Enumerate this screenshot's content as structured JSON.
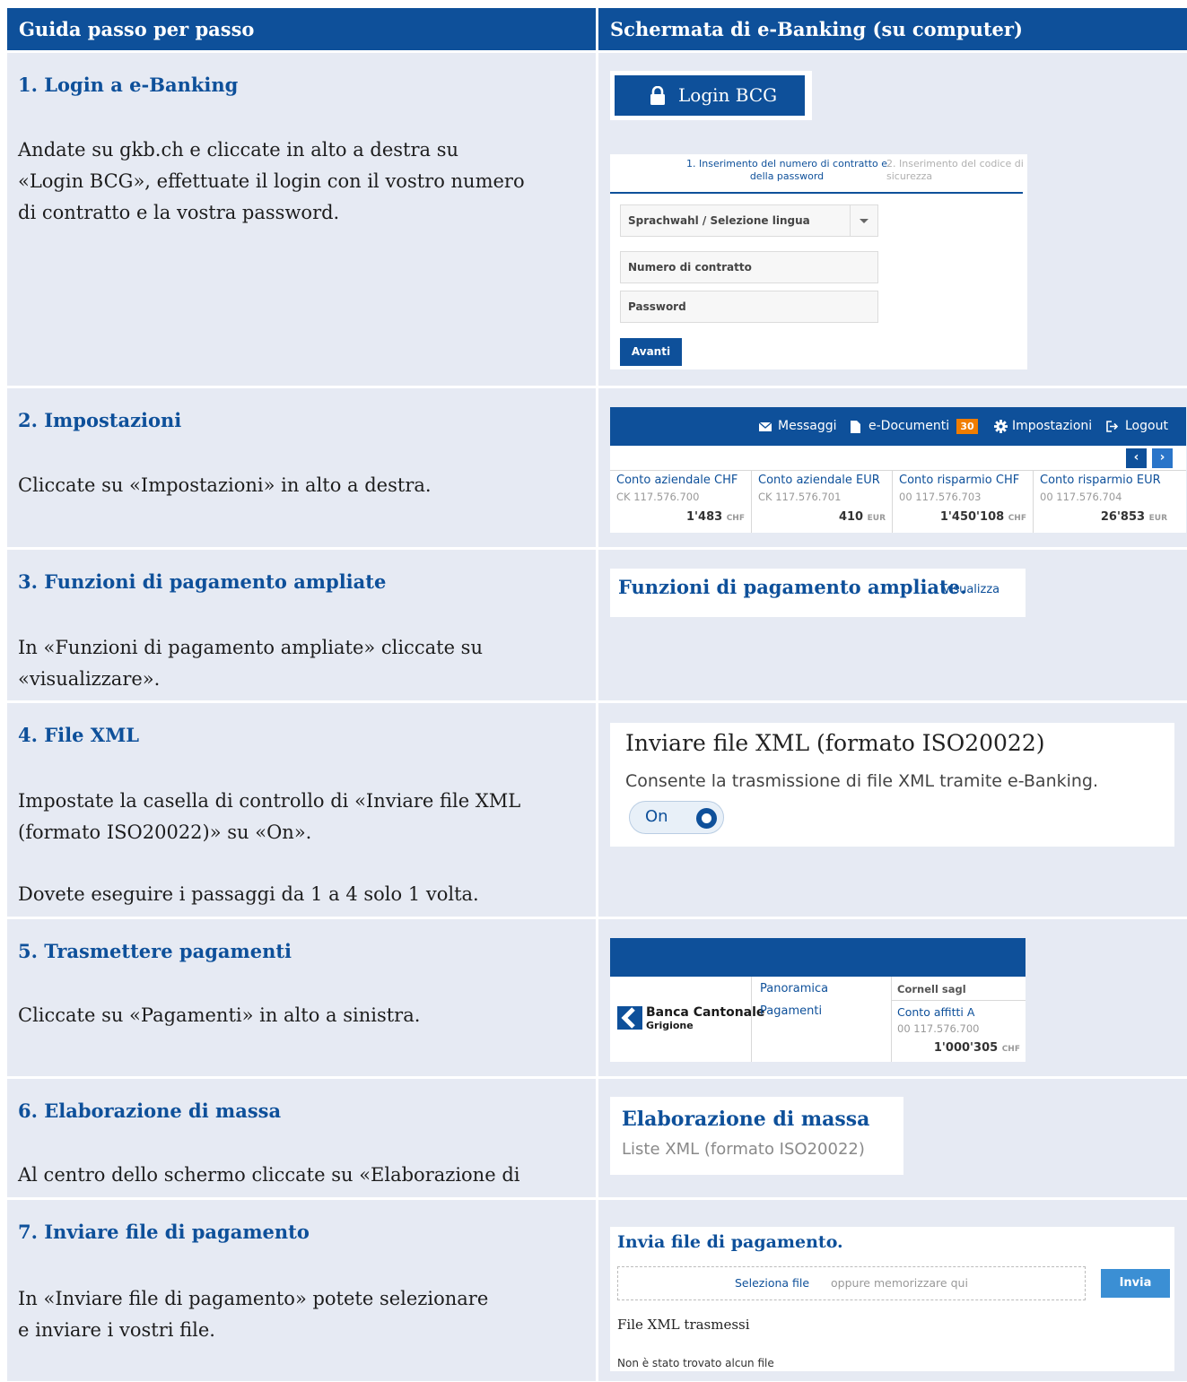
{
  "header": {
    "left": "Guida passo per passo",
    "right": "Schermata di e-Banking (su computer)"
  },
  "steps": [
    {
      "title": "1. Login a e-Banking",
      "text": "Andate su gkb.ch e cliccate in alto a destra su\n«Login BCG», effettuate il login con il vostro numero\ndi contratto e la vostra password."
    },
    {
      "title": "2. Impostazioni",
      "text": "Cliccate su «Impostazioni» in alto a destra."
    },
    {
      "title": "3. Funzioni di pagamento ampliate",
      "text": "In «Funzioni di pagamento ampliate» cliccate su\n«visualizzare»."
    },
    {
      "title": "4. File XML",
      "text": "Impostate la casella di controllo di «Inviare file XML\n(formato ISO20022)» su «On».",
      "note": "Dovete eseguire i passaggi da 1 a 4 solo 1 volta."
    },
    {
      "title": "5. Trasmettere pagamenti",
      "text": "Cliccate su «Pagamenti» in alto a sinistra."
    },
    {
      "title": "6. Elaborazione di massa",
      "text": "Al centro dello schermo cliccate su «Elaborazione di massa»."
    },
    {
      "title": "7. Inviare file di pagamento",
      "text": "In «Inviare file di pagamento» potete selezionare\ne inviare i vostri file."
    }
  ],
  "login": {
    "button_label": "Login BCG",
    "step1": "1. Inserimento del numero di contratto e\ndella password",
    "step2": "2. Inserimento del codice di\nsicurezza",
    "language_select": "Sprachwahl / Selezione lingua",
    "contract_placeholder": "Numero di contratto",
    "password_placeholder": "Password",
    "submit": "Avanti"
  },
  "topbar": {
    "messages": "Messaggi",
    "documents": "e-Documenti",
    "documents_badge": "30",
    "settings": "Impostazioni",
    "logout": "Logout",
    "accounts": [
      {
        "name": "Conto aziendale CHF",
        "number": "CK 117.576.700",
        "amount": "1'483",
        "currency": "CHF"
      },
      {
        "name": "Conto aziendale EUR",
        "number": "CK 117.576.701",
        "amount": "410",
        "currency": "EUR"
      },
      {
        "name": "Conto risparmio CHF",
        "number": "00 117.576.703",
        "amount": "1'450'108",
        "currency": "CHF"
      },
      {
        "name": "Conto risparmio EUR",
        "number": "00 117.576.704",
        "amount": "26'853",
        "currency": "EUR"
      }
    ]
  },
  "extended": {
    "title": "Funzioni di pagamento ampliate.",
    "link": "visualizza"
  },
  "xml": {
    "title": "Inviare file XML (formato ISO20022)",
    "description": "Consente la trasmissione di file XML tramite e-Banking.",
    "toggle": "On"
  },
  "nav": {
    "bank_name": "Banca Cantonale",
    "bank_sub": "Grigione",
    "overview": "Panoramica",
    "payments": "Pagamenti",
    "company": "Cornell sagl",
    "account_name": "Conto affitti A",
    "account_number": "00 117.576.700",
    "amount": "1'000'305",
    "currency": "CHF"
  },
  "mass": {
    "title": "Elaborazione di massa",
    "subtitle": "Liste XML (formato ISO20022)"
  },
  "upload": {
    "title": "Invia file di pagamento.",
    "select": "Seleziona file",
    "or_drop": "oppure memorizzare qui",
    "send": "Invia",
    "sent_title": "File XML trasmessi",
    "empty": "Non è stato trovato alcun file"
  },
  "colors": {
    "primary": "#0e509a",
    "row_bg": "#e6eaf3",
    "badge": "#f07d00"
  }
}
